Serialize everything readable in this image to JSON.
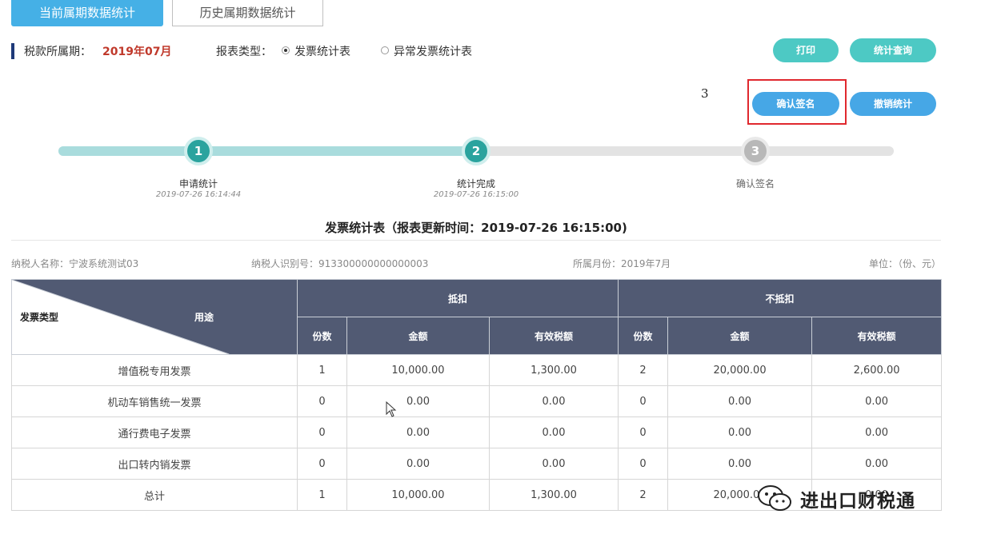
{
  "tabs": {
    "current": "当前属期数据统计",
    "history": "历史属期数据统计"
  },
  "period": {
    "label": "税款所属期：",
    "value": "2019年07月"
  },
  "report_type": {
    "label": "报表类型：",
    "options": [
      "发票统计表",
      "异常发票统计表"
    ],
    "selected": "发票统计表"
  },
  "buttons": {
    "print": "打印",
    "query": "统计查询",
    "confirm_sign": "确认签名",
    "cancel_stat": "撤销统计"
  },
  "annotation": "3",
  "steps": [
    {
      "number": "1",
      "name": "申请统计",
      "time": "2019-07-26 16:14:44",
      "status": "done"
    },
    {
      "number": "2",
      "name": "统计完成",
      "time": "2019-07-26 16:15:00",
      "status": "done"
    },
    {
      "number": "3",
      "name": "确认签名",
      "time": "",
      "status": "pending"
    }
  ],
  "report_title": "发票统计表（报表更新时间：2019-07-26 16:15:00)",
  "meta": {
    "taxpayer_name": "纳税人名称：宁波系统测试03",
    "taxpayer_id": "纳税人识别号：913300000000000003",
    "month": "所属月份：2019年7月",
    "unit": "单位：（份、元）"
  },
  "table": {
    "corner_left": "发票类型",
    "corner_right": "用途",
    "group_deduct": "抵扣",
    "group_nondeduct": "不抵扣",
    "subheaders": [
      "份数",
      "金额",
      "有效税额",
      "份数",
      "金额",
      "有效税额"
    ],
    "rows": [
      {
        "type": "增值税专用发票",
        "cells": [
          "1",
          "10,000.00",
          "1,300.00",
          "2",
          "20,000.00",
          "2,600.00"
        ]
      },
      {
        "type": "机动车销售统一发票",
        "cells": [
          "0",
          "0.00",
          "0.00",
          "0",
          "0.00",
          "0.00"
        ]
      },
      {
        "type": "通行费电子发票",
        "cells": [
          "0",
          "0.00",
          "0.00",
          "0",
          "0.00",
          "0.00"
        ]
      },
      {
        "type": "出口转内销发票",
        "cells": [
          "0",
          "0.00",
          "0.00",
          "0",
          "0.00",
          "0.00"
        ]
      },
      {
        "type": "总计",
        "cells": [
          "1",
          "10,000.00",
          "1,300.00",
          "2",
          "20,000.00",
          "0.00"
        ]
      }
    ]
  },
  "watermark": "进出口财税通"
}
